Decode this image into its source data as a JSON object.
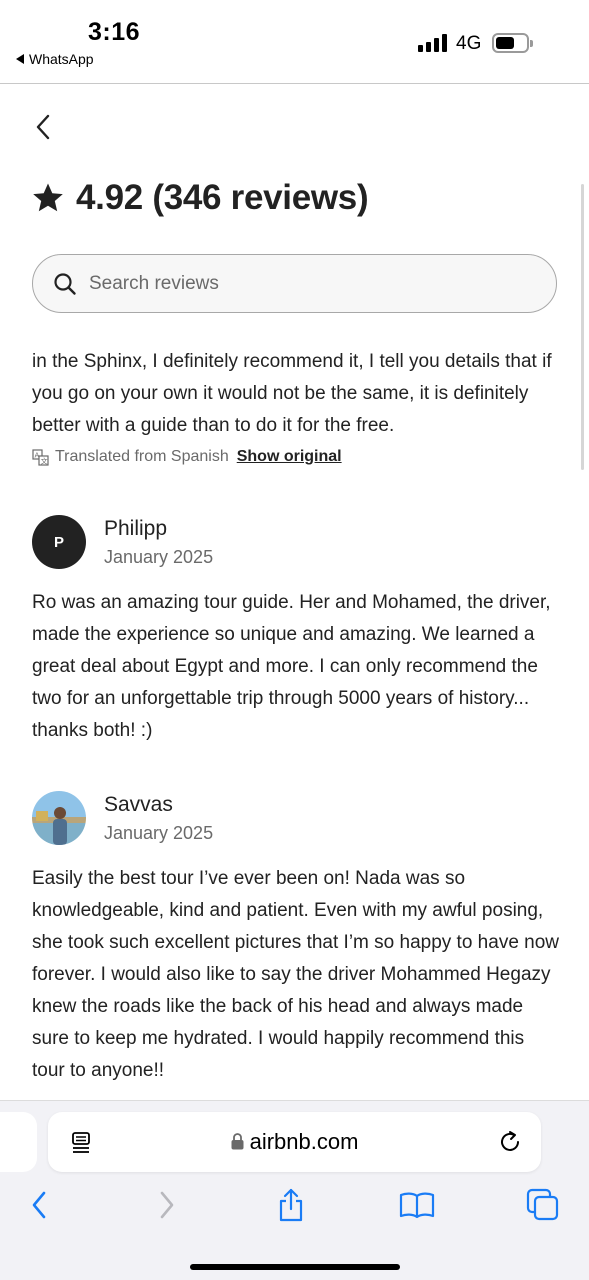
{
  "status_bar": {
    "time": "3:16",
    "back_app": "WhatsApp",
    "network": "4G"
  },
  "header": {
    "rating_title": "4.92 (346 reviews)"
  },
  "search": {
    "placeholder": "Search reviews"
  },
  "reviews": [
    {
      "text": "in the Sphinx, I definitely recommend it, I tell you details that if you go on your own it would not be the same, it is definitely better with a guide than to do it for the free.",
      "translated_note": "Translated from Spanish",
      "show_original": "Show original"
    },
    {
      "name": "Philipp",
      "initial": "P",
      "date": "January 2025",
      "text": "Ro was an amazing tour guide. Her and Mohamed, the driver, made the experience so unique and amazing. We learned a great deal about Egypt and more. I can only recommend the two for an unforgettable trip through 5000 years of history... thanks both! :)"
    },
    {
      "name": "Savvas",
      "date": "January 2025",
      "text": "Easily the best tour I’ve ever been on! Nada was so knowledgeable, kind and patient. Even with my awful posing, she took such excellent pictures that I’m so happy to have now forever. I would also like to say the driver Mohammed Hegazy knew the roads like the back of his head and always made sure to keep me hydrated. I would happily recommend this tour to anyone!!"
    }
  ],
  "browser": {
    "url": "airbnb.com"
  },
  "colors": {
    "text": "#222222",
    "muted": "#6a6a6a",
    "ios_blue": "#1a7cf5",
    "toolbar_bg": "#f2f2f6"
  },
  "icons": [
    "chevron-left-icon",
    "star-icon",
    "search-icon",
    "translate-icon",
    "reader-icon",
    "lock-icon",
    "reload-icon",
    "share-icon",
    "bookmarks-icon",
    "tabs-icon"
  ]
}
